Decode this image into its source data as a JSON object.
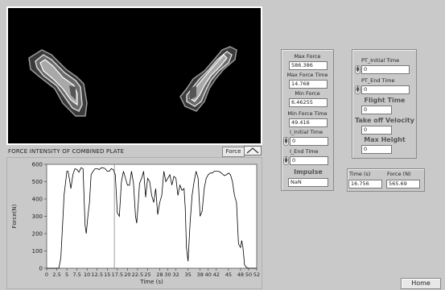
{
  "heatmap": {
    "background": "#000000",
    "blob_colors": [
      "#3a3a3a",
      "#7a7a7a",
      "#c8c8c8",
      "#ffffff"
    ]
  },
  "plate": {
    "title": "FORCE INTENSITY OF COMBINED PLATE",
    "force_label": "Force",
    "toggle_icon": "chevron-up-icon"
  },
  "stats": {
    "max_force_label": "Max Force",
    "max_force": "586.386",
    "max_force_time_label": "Max Force Time",
    "max_force_time": "14.768",
    "min_force_label": "Min Force",
    "min_force": "6.46255",
    "min_force_time_label": "Min Force Time",
    "min_force_time": "49.416",
    "i_initial_time_label": "I_Initial Time",
    "i_initial_time": "0",
    "i_end_time_label": "I_End Time",
    "i_end_time": "0",
    "impulse_label": "Impulse",
    "impulse": "NaN"
  },
  "flight": {
    "pt_initial_label": "PT_Initial Time",
    "pt_initial": "0",
    "pt_end_label": "PT_End Time",
    "pt_end": "0",
    "flight_time_label": "Flight Time",
    "flight_time": "0",
    "takeoff_label": "Take off Velocity",
    "takeoff": "0",
    "max_height_label": "Max Height",
    "max_height": "0"
  },
  "cursor": {
    "time_label": "Time (s)",
    "time": "16.756",
    "force_label": "Force (N)",
    "force": "565.69"
  },
  "buttons": {
    "home": "Home"
  },
  "chart_data": {
    "type": "line",
    "xlabel": "Time (s)",
    "ylabel": "Force(N)",
    "xlim": [
      0,
      52
    ],
    "ylim": [
      0,
      600
    ],
    "xticks": [
      0,
      2.5,
      5,
      7.5,
      10,
      12.5,
      15,
      17.5,
      20,
      22.5,
      25,
      28,
      30,
      32,
      35,
      38,
      40,
      42,
      45,
      48,
      50,
      52
    ],
    "xtick_labels": [
      "0",
      "2.5",
      "5",
      "7.5",
      "10",
      "12.5",
      "15",
      "17.5",
      "20",
      "22.5",
      "25",
      "28",
      "30",
      "32",
      "35",
      "38",
      "40",
      "42",
      "45",
      "48",
      "50",
      "52"
    ],
    "yticks": [
      0,
      100,
      200,
      300,
      400,
      500,
      600
    ],
    "cursor_x": 16.756,
    "line_color": "#000000",
    "plot_bg": "#ffffff",
    "x": [
      0,
      2.5,
      3.0,
      3.5,
      4.0,
      4.3,
      4.7,
      5.0,
      5.3,
      5.6,
      6.0,
      6.5,
      7.0,
      7.5,
      8.0,
      8.5,
      9.0,
      9.5,
      9.8,
      10.2,
      10.6,
      11.0,
      11.5,
      12.0,
      12.5,
      13.0,
      13.5,
      14.0,
      14.5,
      15.0,
      15.5,
      16.0,
      16.5,
      17.0,
      17.5,
      18.0,
      18.5,
      19.0,
      19.5,
      20.0,
      20.5,
      21.0,
      21.5,
      22.0,
      22.3,
      22.7,
      23.0,
      23.5,
      24.0,
      24.5,
      25.0,
      25.5,
      26.0,
      26.5,
      27.0,
      27.5,
      28.0,
      28.5,
      29.0,
      29.5,
      30.0,
      30.5,
      31.0,
      31.5,
      32.0,
      32.5,
      33.0,
      33.5,
      34.0,
      34.3,
      34.6,
      35.0,
      35.5,
      36.0,
      36.5,
      37.0,
      37.5,
      38.0,
      38.5,
      39.0,
      39.5,
      40.0,
      40.5,
      41.0,
      41.5,
      42.0,
      42.5,
      43.0,
      43.5,
      44.0,
      44.5,
      45.0,
      45.5,
      46.0,
      46.5,
      47.0,
      47.5,
      48.0,
      48.3,
      48.6,
      49.0,
      49.4,
      50.0,
      51.0,
      52.0
    ],
    "y": [
      0,
      0,
      0,
      60,
      280,
      420,
      500,
      560,
      560,
      520,
      460,
      540,
      575,
      570,
      555,
      580,
      575,
      250,
      200,
      300,
      380,
      540,
      560,
      575,
      575,
      570,
      580,
      580,
      575,
      560,
      560,
      575,
      570,
      540,
      320,
      300,
      500,
      560,
      520,
      480,
      480,
      560,
      490,
      300,
      260,
      380,
      490,
      520,
      560,
      410,
      520,
      500,
      420,
      380,
      460,
      310,
      380,
      420,
      560,
      500,
      520,
      540,
      480,
      530,
      520,
      420,
      480,
      450,
      460,
      350,
      120,
      40,
      260,
      420,
      500,
      560,
      520,
      300,
      330,
      460,
      520,
      540,
      550,
      550,
      560,
      560,
      560,
      555,
      545,
      535,
      540,
      550,
      540,
      500,
      420,
      380,
      140,
      120,
      160,
      120,
      20,
      6,
      0,
      0,
      0
    ]
  }
}
